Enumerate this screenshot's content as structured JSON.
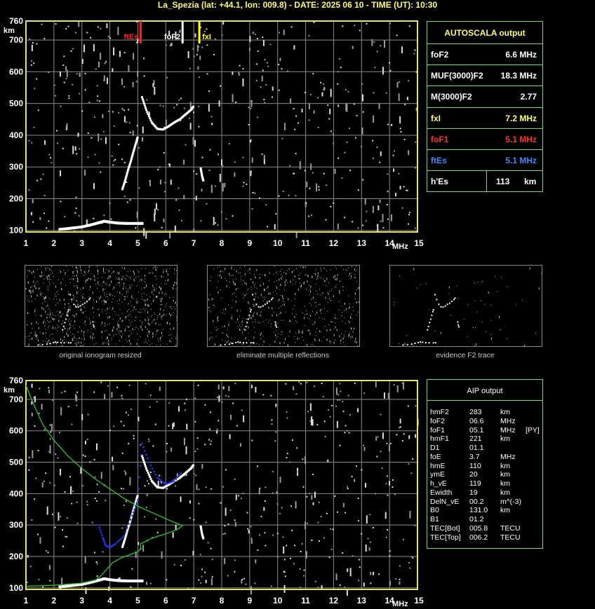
{
  "header": "La_Spezia (lat: +44.1, lon: 009.8) - DATE: 2025 06 10 - TIME (UT): 10:30",
  "colors": {
    "axis": "#e6e66a",
    "grid": "#8a8a8a",
    "panel_border": "#6fdc6f",
    "foF1": "#ff2020",
    "fxI": "#ffff00",
    "ftEs": "#2a7cff",
    "profile": "#22cc22",
    "fit": "#2233ee",
    "trace": "#ffffff",
    "label_yellow": "#ffff66"
  },
  "autoscala": {
    "title": "AUTOSCALA output",
    "rows": [
      {
        "label": "foF2",
        "value": "6.6 MHz",
        "color": "#ffffff"
      },
      {
        "label": "MUF(3000)F2",
        "value": "18.3 MHz",
        "color": "#ffffff"
      },
      {
        "label": "M(3000)F2",
        "value": "2.77",
        "color": "#ffffff"
      },
      {
        "label": "fxI",
        "value": "7.2 MHz",
        "color": "#ffff66"
      },
      {
        "label": "foF1",
        "value": "5.1 MHz",
        "color": "#ff3030"
      },
      {
        "label": "ftEs",
        "value": "5.1 MHz",
        "color": "#3a8cff"
      },
      {
        "label": "h'Es",
        "value": "113",
        "unit": "km",
        "color": "#ffffff"
      }
    ]
  },
  "aip": {
    "title": "AIP output",
    "rows": [
      [
        "hmF2",
        "283",
        "km",
        ""
      ],
      [
        "foF2",
        "06.6",
        "MHz",
        ""
      ],
      [
        "foF1",
        "05.1",
        "MHz",
        "[PY]"
      ],
      [
        "hmF1",
        "221",
        "km",
        ""
      ],
      [
        "D1",
        "01.1",
        "",
        ""
      ],
      [
        "foE",
        "3.7",
        "MHz",
        ""
      ],
      [
        "hmE",
        "110",
        "km",
        ""
      ],
      [
        "ymE",
        "20",
        "km",
        ""
      ],
      [
        "h_vE",
        "119",
        "km",
        ""
      ],
      [
        "Ewidth",
        "19",
        "km",
        ""
      ],
      [
        "DelN_vE",
        "00.2",
        "m^(-3)",
        ""
      ],
      [
        "B0",
        "131.0",
        "km",
        ""
      ],
      [
        "B1",
        "01.2",
        "",
        ""
      ],
      [
        "TEC[Bot]",
        "005.8",
        "TECU",
        ""
      ],
      [
        "TEC[Top]",
        "006.2",
        "TECU",
        ""
      ]
    ]
  },
  "thumbnails": {
    "captions": [
      "original ionogram resized",
      "eliminate multiple reflections",
      "evidence F2 trace"
    ]
  },
  "chart_data": [
    {
      "type": "scatter",
      "name": "top-ionogram",
      "xlabel": "MHz",
      "ylabel": "km",
      "xlim": [
        1,
        15
      ],
      "ylim": [
        95,
        760
      ],
      "xticks": [
        1,
        2,
        3,
        4,
        5,
        6,
        7,
        8,
        9,
        10,
        11,
        12,
        13,
        14,
        15
      ],
      "yticks": [
        100,
        200,
        300,
        400,
        500,
        600,
        700,
        760
      ],
      "grid": true,
      "markers": [
        {
          "label": "ftEs",
          "x": 5.1,
          "color": "#ff2020"
        },
        {
          "label": "foF2",
          "x": 6.6,
          "color": "#ffffff"
        },
        {
          "label": "fxI",
          "x": 7.2,
          "color": "#ffff00"
        }
      ],
      "traces": {
        "Es": [
          [
            2.2,
            104
          ],
          [
            2.6,
            108
          ],
          [
            3.0,
            112
          ],
          [
            3.3,
            118
          ],
          [
            3.6,
            125
          ],
          [
            3.8,
            130
          ],
          [
            4.0,
            127
          ],
          [
            4.3,
            124
          ],
          [
            4.6,
            123
          ],
          [
            5.0,
            123
          ],
          [
            5.2,
            123
          ]
        ],
        "F1": [
          [
            4.45,
            230
          ],
          [
            4.55,
            258
          ],
          [
            4.65,
            290
          ],
          [
            4.75,
            318
          ],
          [
            4.85,
            350
          ],
          [
            4.95,
            380
          ],
          [
            5.0,
            395
          ]
        ],
        "F2": [
          [
            5.15,
            520
          ],
          [
            5.3,
            480
          ],
          [
            5.5,
            440
          ],
          [
            5.7,
            420
          ],
          [
            5.9,
            418
          ],
          [
            6.1,
            428
          ],
          [
            6.3,
            440
          ],
          [
            6.5,
            450
          ],
          [
            6.7,
            465
          ],
          [
            6.9,
            480
          ],
          [
            7.0,
            492
          ]
        ],
        "X": [
          [
            7.25,
            295
          ],
          [
            7.3,
            270
          ],
          [
            7.35,
            255
          ]
        ]
      }
    },
    {
      "type": "scatter",
      "name": "bottom-ionogram",
      "xlabel": "MHz",
      "ylabel": "km",
      "xlim": [
        1,
        15
      ],
      "ylim": [
        95,
        760
      ],
      "xticks": [
        1,
        2,
        3,
        4,
        5,
        6,
        7,
        8,
        9,
        10,
        11,
        12,
        13,
        14,
        15
      ],
      "yticks": [
        100,
        200,
        300,
        400,
        500,
        600,
        700,
        760
      ],
      "grid": true,
      "profile": [
        [
          1.0,
          745
        ],
        [
          1.2,
          700
        ],
        [
          1.6,
          620
        ],
        [
          2.0,
          570
        ],
        [
          2.5,
          520
        ],
        [
          3.0,
          480
        ],
        [
          3.5,
          445
        ],
        [
          4.0,
          415
        ],
        [
          4.5,
          385
        ],
        [
          5.0,
          360
        ],
        [
          5.5,
          340
        ],
        [
          6.0,
          320
        ],
        [
          6.4,
          305
        ],
        [
          6.6,
          298
        ],
        [
          6.4,
          285
        ],
        [
          6.0,
          272
        ],
        [
          5.5,
          258
        ],
        [
          5.1,
          240
        ],
        [
          5.1,
          225
        ],
        [
          5.0,
          215
        ],
        [
          4.7,
          205
        ],
        [
          4.4,
          195
        ],
        [
          4.1,
          180
        ],
        [
          3.9,
          160
        ],
        [
          3.7,
          140
        ],
        [
          3.5,
          125
        ],
        [
          3.0,
          115
        ],
        [
          2.0,
          108
        ],
        [
          1.0,
          105
        ]
      ],
      "fit": [
        [
          3.6,
          300
        ],
        [
          3.75,
          260
        ],
        [
          3.85,
          235
        ],
        [
          4.0,
          228
        ],
        [
          4.2,
          240
        ],
        [
          4.5,
          265
        ],
        [
          4.8,
          330
        ],
        [
          5.0,
          380
        ],
        [
          5.15,
          560
        ],
        [
          5.4,
          500
        ],
        [
          5.7,
          450
        ],
        [
          6.0,
          430
        ],
        [
          6.3,
          440
        ],
        [
          6.6,
          470
        ]
      ]
    }
  ]
}
